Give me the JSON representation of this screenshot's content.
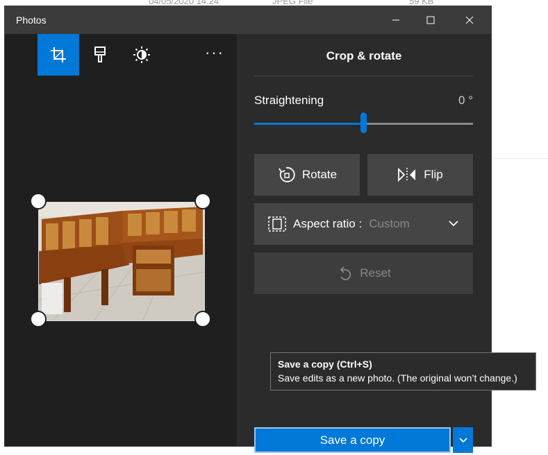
{
  "background": {
    "file_date": "04/05/2020 14.24",
    "file_type": "JPEG File",
    "file_size": "59 KB"
  },
  "window": {
    "title": "Photos",
    "controls": {
      "minimize": "–",
      "maximize": "☐",
      "close": "✕"
    }
  },
  "toolbar": {
    "tools": [
      {
        "name": "crop-icon",
        "active": true
      },
      {
        "name": "filters-icon",
        "active": false
      },
      {
        "name": "adjustments-icon",
        "active": false
      }
    ],
    "more_label": "···"
  },
  "panel": {
    "title": "Crop & rotate",
    "straightening_label": "Straightening",
    "straightening_value": "0 °",
    "straightening_fraction": 0.5,
    "rotate_label": "Rotate",
    "flip_label": "Flip",
    "aspect_label": "Aspect ratio :",
    "aspect_value": "Custom",
    "reset_label": "Reset",
    "save_label": "Save a copy"
  },
  "tooltip": {
    "title": "Save a copy (Ctrl+S)",
    "body": "Save edits as a new photo. (The original won’t change.)"
  },
  "colors": {
    "accent": "#0078d7",
    "window_bg": "#2b2b2b",
    "image_bg": "#1f1f1f",
    "button_bg": "#454545"
  }
}
